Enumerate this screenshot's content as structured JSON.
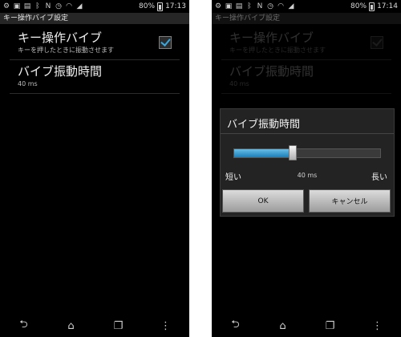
{
  "status_left": {
    "time": "17:13",
    "battery_percent": "80%",
    "battery_level": 0.8
  },
  "status_right": {
    "time": "17:14",
    "battery_percent": "80%",
    "battery_level": 0.8
  },
  "screen_title": "キー操作バイブ設定",
  "prefs": {
    "key_vibration": {
      "title": "キー操作バイブ",
      "summary": "キーを押したときに振動させます",
      "checked": true
    },
    "vibration_time": {
      "title": "バイブ振動時間",
      "summary": "40 ms"
    }
  },
  "dialog": {
    "title": "バイブ振動時間",
    "slider_level": 0.4,
    "label_short": "短い",
    "value_text": "40 ms",
    "label_long": "長い",
    "ok_label": "OK",
    "cancel_label": "キャンセル"
  },
  "icons": {
    "status": [
      "usb-debug-icon",
      "android-icon",
      "image-icon",
      "bluetooth-icon",
      "nfc-icon",
      "alarm-icon",
      "wifi-icon",
      "signal-icon"
    ],
    "nav": [
      "back-icon",
      "home-icon",
      "recent-apps-icon",
      "menu-icon"
    ]
  },
  "colors": {
    "accent": "#37a9e0",
    "background": "#000000",
    "titlebar": "#262626"
  }
}
